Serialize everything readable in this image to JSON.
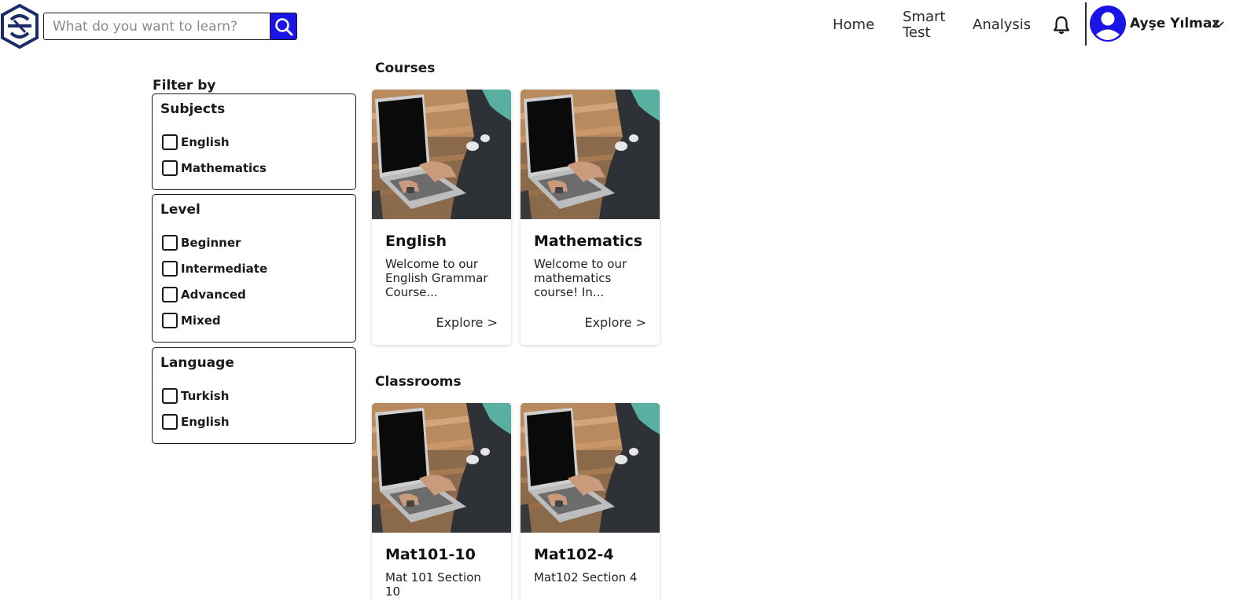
{
  "header": {
    "logo_icon": "brand-logo-icon",
    "search": {
      "placeholder": "What do you want to learn?",
      "value": ""
    },
    "nav": {
      "home": "Home",
      "smart_test": "Smart Test",
      "analysis": "Analysis"
    },
    "notification_icon": "bell-icon",
    "user": {
      "name": "Ayşe Yılmaz",
      "avatar_icon": "user-avatar-icon"
    },
    "accent_color": "#1a14e6"
  },
  "filters": {
    "title": "Filter by",
    "subjects": {
      "label": "Subjects",
      "options": [
        "English",
        "Mathematics"
      ]
    },
    "level": {
      "label": "Level",
      "options": [
        "Beginner",
        "Intermediate",
        "Advanced",
        "Mixed"
      ]
    },
    "language": {
      "label": "Language",
      "options": [
        "Turkish",
        "English"
      ]
    }
  },
  "courses": {
    "title": "Courses",
    "items": [
      {
        "title": "English",
        "desc": "Welcome to our English Grammar Course...",
        "link": "Explore >"
      },
      {
        "title": "Mathematics",
        "desc": "Welcome to our mathematics course! In...",
        "link": "Explore >"
      }
    ]
  },
  "classrooms": {
    "title": "Classrooms",
    "items": [
      {
        "title": "Mat101-10",
        "desc": "Mat 101 Section 10"
      },
      {
        "title": "Mat102-4",
        "desc": "Mat102 Section 4"
      }
    ]
  }
}
